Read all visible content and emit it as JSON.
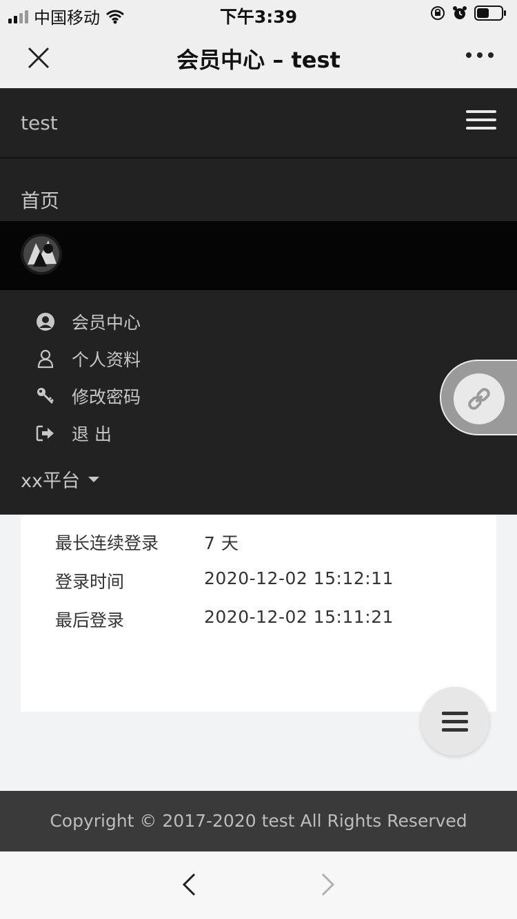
{
  "status": {
    "carrier": "中国移动",
    "time": "下午3:39"
  },
  "window": {
    "title": "会员中心 – test"
  },
  "navbar": {
    "brand": "test"
  },
  "menu": {
    "home": "首页",
    "items": [
      {
        "label": "会员中心",
        "icon": "user-circle-icon"
      },
      {
        "label": "个人资料",
        "icon": "user-icon"
      },
      {
        "label": "修改密码",
        "icon": "key-icon"
      },
      {
        "label": "退 出",
        "icon": "sign-out-icon"
      }
    ],
    "platform": "xx平台"
  },
  "info": {
    "rows": [
      {
        "label": "最长连续登录",
        "value": "7 天"
      },
      {
        "label": "登录时间",
        "value": "2020-12-02 15:12:11"
      },
      {
        "label": "最后登录",
        "value": "2020-12-02 15:11:21"
      }
    ]
  },
  "footer": {
    "copyright": "Copyright © 2017-2020 test All Rights Reserved"
  },
  "colors": {
    "dark_bg": "#222222",
    "user_bar": "#050505",
    "page_bg": "#f2f3f5"
  }
}
